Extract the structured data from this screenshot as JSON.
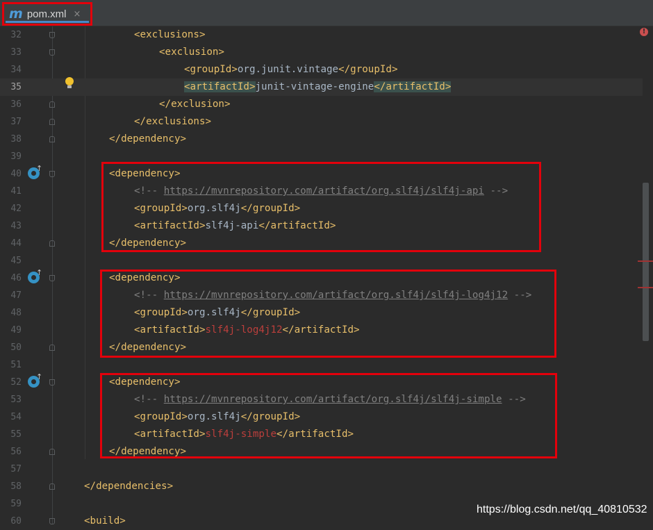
{
  "tab": {
    "icon": "maven-m-icon",
    "icon_glyph": "m",
    "name": "pom.xml",
    "close": "×"
  },
  "lines": [
    {
      "n": "32"
    },
    {
      "n": "33"
    },
    {
      "n": "34"
    },
    {
      "n": "35"
    },
    {
      "n": "36"
    },
    {
      "n": "37"
    },
    {
      "n": "38"
    },
    {
      "n": "39"
    },
    {
      "n": "40"
    },
    {
      "n": "41"
    },
    {
      "n": "42"
    },
    {
      "n": "43"
    },
    {
      "n": "44"
    },
    {
      "n": "45"
    },
    {
      "n": "46"
    },
    {
      "n": "47"
    },
    {
      "n": "48"
    },
    {
      "n": "49"
    },
    {
      "n": "50"
    },
    {
      "n": "51"
    },
    {
      "n": "52"
    },
    {
      "n": "53"
    },
    {
      "n": "54"
    },
    {
      "n": "55"
    },
    {
      "n": "56"
    },
    {
      "n": "57"
    },
    {
      "n": "58"
    },
    {
      "n": "59"
    },
    {
      "n": "60"
    }
  ],
  "code": {
    "l32": "<exclusions>",
    "l33": "<exclusion>",
    "l34_open": "<groupId>",
    "l34_text": "org.junit.vintage",
    "l34_close": "</groupId>",
    "l35_open": "<artifactId>",
    "l35_text": "junit-vintage-engine",
    "l35_close": "</artifactId>",
    "l36": "</exclusion>",
    "l37": "</exclusions>",
    "l38": "</dependency>",
    "l40": "<dependency>",
    "l41_open": "<!-- ",
    "l41_url": "https://mvnrepository.com/artifact/org.slf4j/slf4j-api",
    "l41_close": " -->",
    "l42_open": "<groupId>",
    "l42_text": "org.slf4j",
    "l42_close": "</groupId>",
    "l43_open": "<artifactId>",
    "l43_text": "slf4j-api",
    "l43_close": "</artifactId>",
    "l44": "</dependency>",
    "l46": "<dependency>",
    "l47_open": "<!-- ",
    "l47_url": "https://mvnrepository.com/artifact/org.slf4j/slf4j-log4j12",
    "l47_close": " -->",
    "l48_open": "<groupId>",
    "l48_text": "org.slf4j",
    "l48_close": "</groupId>",
    "l49_open": "<artifactId>",
    "l49_text": "slf4j-log4j12",
    "l49_close": "</artifactId>",
    "l50": "</dependency>",
    "l52": "<dependency>",
    "l53_open": "<!-- ",
    "l53_url": "https://mvnrepository.com/artifact/org.slf4j/slf4j-simple",
    "l53_close": " -->",
    "l54_open": "<groupId>",
    "l54_text": "org.slf4j",
    "l54_close": "</groupId>",
    "l55_open": "<artifactId>",
    "l55_text": "slf4j-simple",
    "l55_close": "</artifactId>",
    "l56": "</dependency>",
    "l58": "</dependencies>",
    "l60": "<build>"
  },
  "gutter": {
    "current_line": "35",
    "intention_icon": "lightbulb-icon",
    "dependency_icon": "maven-dependency-icon",
    "arrow_glyph": "↑"
  },
  "status": {
    "error_indicator": "!"
  },
  "watermark": "https://blog.csdn.net/qq_40810532",
  "colors": {
    "background": "#2b2b2b",
    "tag": "#e8bf6a",
    "text": "#a9b7c6",
    "comment": "#808080",
    "unresolved": "#bc3f3c",
    "highlight_box": "#e3000b"
  }
}
